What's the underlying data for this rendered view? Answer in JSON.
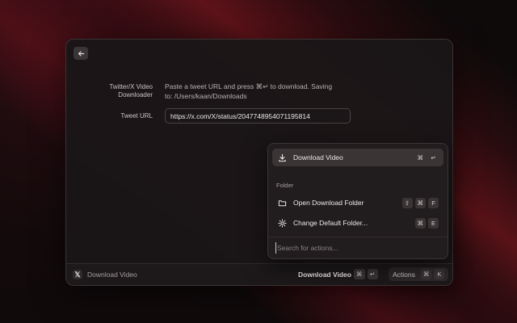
{
  "form": {
    "extension_label": "Twitter/X Video\nDownloader",
    "description": "Paste a tweet URL and press ⌘↵ to download. Saving to: /Users/kaan/Downloads",
    "url_label": "Tweet URL",
    "url_value": "https://x.com/X/status/2047748954071195814"
  },
  "bottom_bar": {
    "app_icon": "x-logo-icon",
    "title": "Download Video",
    "primary_action": "Download Video",
    "primary_keys": [
      "⌘",
      "↵"
    ],
    "actions_label": "Actions",
    "actions_keys": [
      "⌘",
      "K"
    ]
  },
  "actions_panel": {
    "items": [
      {
        "label": "Download Video",
        "icon": "download-icon",
        "keys": [
          "⌘",
          "↵"
        ],
        "selected": true
      }
    ],
    "section": "Folder",
    "folder_items": [
      {
        "label": "Open Download Folder",
        "icon": "folder-icon",
        "keys": [
          "⇧",
          "⌘",
          "F"
        ]
      },
      {
        "label": "Change Default Folder...",
        "icon": "gear-icon",
        "keys": [
          "⌘",
          "E"
        ]
      }
    ],
    "search_placeholder": "Search for actions..."
  }
}
